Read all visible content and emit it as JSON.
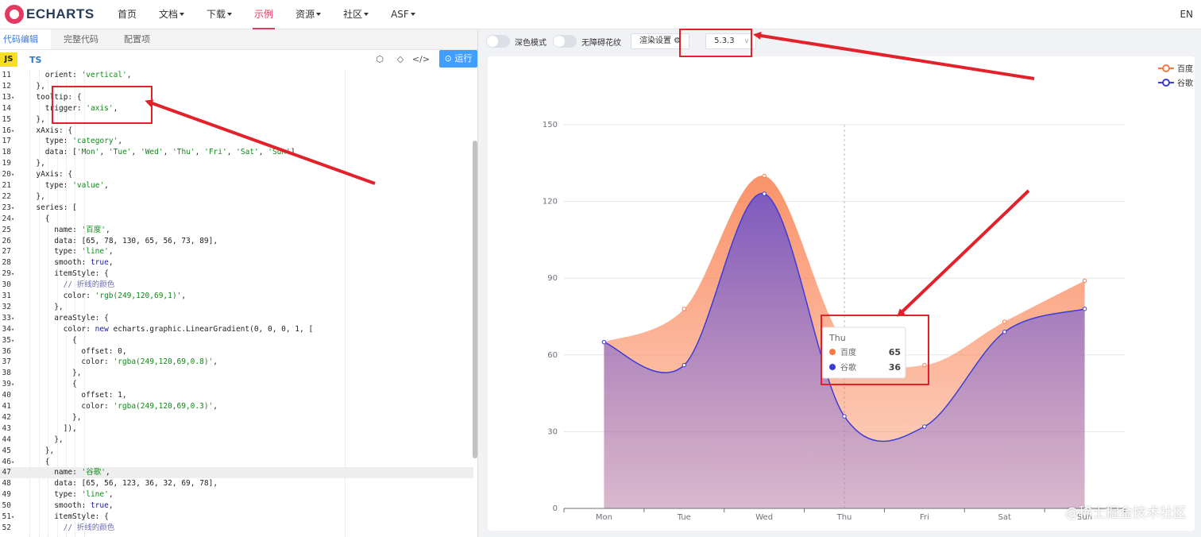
{
  "navbar": {
    "logo_text": "ECHARTS",
    "items": [
      {
        "label": "首页",
        "dropdown": false,
        "active": false
      },
      {
        "label": "文档",
        "dropdown": true,
        "active": false
      },
      {
        "label": "下载",
        "dropdown": true,
        "active": false
      },
      {
        "label": "示例",
        "dropdown": false,
        "active": true
      },
      {
        "label": "资源",
        "dropdown": true,
        "active": false
      },
      {
        "label": "社区",
        "dropdown": true,
        "active": false
      },
      {
        "label": "ASF",
        "dropdown": true,
        "active": false
      }
    ],
    "lang": "EN"
  },
  "editor": {
    "tabs": [
      "代码编辑",
      "完整代码",
      "配置项"
    ],
    "lang_js": "JS",
    "lang_ts": "TS",
    "run_label": "运行",
    "lines": [
      {
        "n": 11,
        "fold": false,
        "indent": 3,
        "text": "orient: 'vertical',"
      },
      {
        "n": 12,
        "fold": false,
        "indent": 2,
        "text": "},"
      },
      {
        "n": 13,
        "fold": true,
        "indent": 2,
        "text": "tooltip: {"
      },
      {
        "n": 14,
        "fold": false,
        "indent": 3,
        "text": "trigger: 'axis',"
      },
      {
        "n": 15,
        "fold": false,
        "indent": 2,
        "text": "},"
      },
      {
        "n": 16,
        "fold": true,
        "indent": 2,
        "text": "xAxis: {"
      },
      {
        "n": 17,
        "fold": false,
        "indent": 3,
        "text": "type: 'category',"
      },
      {
        "n": 18,
        "fold": false,
        "indent": 3,
        "text": "data: ['Mon', 'Tue', 'Wed', 'Thu', 'Fri', 'Sat', 'Sun']"
      },
      {
        "n": 19,
        "fold": false,
        "indent": 2,
        "text": "},"
      },
      {
        "n": 20,
        "fold": true,
        "indent": 2,
        "text": "yAxis: {"
      },
      {
        "n": 21,
        "fold": false,
        "indent": 3,
        "text": "type: 'value',"
      },
      {
        "n": 22,
        "fold": false,
        "indent": 2,
        "text": "},"
      },
      {
        "n": 23,
        "fold": true,
        "indent": 2,
        "text": "series: ["
      },
      {
        "n": 24,
        "fold": true,
        "indent": 3,
        "text": "{"
      },
      {
        "n": 25,
        "fold": false,
        "indent": 4,
        "text": "name: '百度',"
      },
      {
        "n": 26,
        "fold": false,
        "indent": 4,
        "text": "data: [65, 78, 130, 65, 56, 73, 89],"
      },
      {
        "n": 27,
        "fold": false,
        "indent": 4,
        "text": "type: 'line',"
      },
      {
        "n": 28,
        "fold": false,
        "indent": 4,
        "text": "smooth: true,"
      },
      {
        "n": 29,
        "fold": true,
        "indent": 4,
        "text": "itemStyle: {"
      },
      {
        "n": 30,
        "fold": false,
        "indent": 5,
        "text": "// 折线的颜色"
      },
      {
        "n": 31,
        "fold": false,
        "indent": 5,
        "text": "color: 'rgb(249,120,69,1)',"
      },
      {
        "n": 32,
        "fold": false,
        "indent": 4,
        "text": "},"
      },
      {
        "n": 33,
        "fold": true,
        "indent": 4,
        "text": "areaStyle: {"
      },
      {
        "n": 34,
        "fold": true,
        "indent": 5,
        "text": "color: new echarts.graphic.LinearGradient(0, 0, 0, 1, ["
      },
      {
        "n": 35,
        "fold": true,
        "indent": 6,
        "text": "{"
      },
      {
        "n": 36,
        "fold": false,
        "indent": 7,
        "text": "offset: 0,"
      },
      {
        "n": 37,
        "fold": false,
        "indent": 7,
        "text": "color: 'rgba(249,120,69,0.8)',"
      },
      {
        "n": 38,
        "fold": false,
        "indent": 6,
        "text": "},"
      },
      {
        "n": 39,
        "fold": true,
        "indent": 6,
        "text": "{"
      },
      {
        "n": 40,
        "fold": false,
        "indent": 7,
        "text": "offset: 1,"
      },
      {
        "n": 41,
        "fold": false,
        "indent": 7,
        "text": "color: 'rgba(249,120,69,0.3)',"
      },
      {
        "n": 42,
        "fold": false,
        "indent": 6,
        "text": "},"
      },
      {
        "n": 43,
        "fold": false,
        "indent": 5,
        "text": "]),"
      },
      {
        "n": 44,
        "fold": false,
        "indent": 4,
        "text": "},"
      },
      {
        "n": 45,
        "fold": false,
        "indent": 3,
        "text": "},"
      },
      {
        "n": 46,
        "fold": true,
        "indent": 3,
        "text": "{"
      },
      {
        "n": 47,
        "fold": false,
        "indent": 4,
        "text": "name: '谷歌',"
      },
      {
        "n": 48,
        "fold": false,
        "indent": 4,
        "text": "data: [65, 56, 123, 36, 32, 69, 78],"
      },
      {
        "n": 49,
        "fold": false,
        "indent": 4,
        "text": "type: 'line',"
      },
      {
        "n": 50,
        "fold": false,
        "indent": 4,
        "text": "smooth: true,"
      },
      {
        "n": 51,
        "fold": true,
        "indent": 4,
        "text": "itemStyle: {"
      },
      {
        "n": 52,
        "fold": false,
        "indent": 5,
        "text": "// 折线的颜色"
      }
    ],
    "highlight_line": 47
  },
  "toolbar": {
    "dark_mode_label": "深色模式",
    "accessibility_label": "无障碍花纹",
    "render_settings_label": "渲染设置 ⚙",
    "version": "5.3.3"
  },
  "watermark": "@稀土掘金技术社区",
  "colors": {
    "brand": "#e43961",
    "baidu_line": "#f97845",
    "google_line": "#3c3cd6",
    "annotation_red": "#e3212a"
  },
  "chart_data": {
    "type": "line",
    "categories": [
      "Mon",
      "Tue",
      "Wed",
      "Thu",
      "Fri",
      "Sat",
      "Sun"
    ],
    "series": [
      {
        "name": "百度",
        "values": [
          65,
          78,
          130,
          65,
          56,
          73,
          89
        ],
        "color": "#f97845"
      },
      {
        "name": "谷歌",
        "values": [
          65,
          56,
          123,
          36,
          32,
          69,
          78
        ],
        "color": "#3c3cd6"
      }
    ],
    "ylim": [
      0,
      150
    ],
    "y_ticks": [
      0,
      30,
      60,
      90,
      120,
      150
    ],
    "smooth": true,
    "area": true,
    "legend_position": "top-right",
    "tooltip": {
      "category": "Thu",
      "rows": [
        {
          "name": "百度",
          "value": 65
        },
        {
          "name": "谷歌",
          "value": 36
        }
      ]
    }
  }
}
